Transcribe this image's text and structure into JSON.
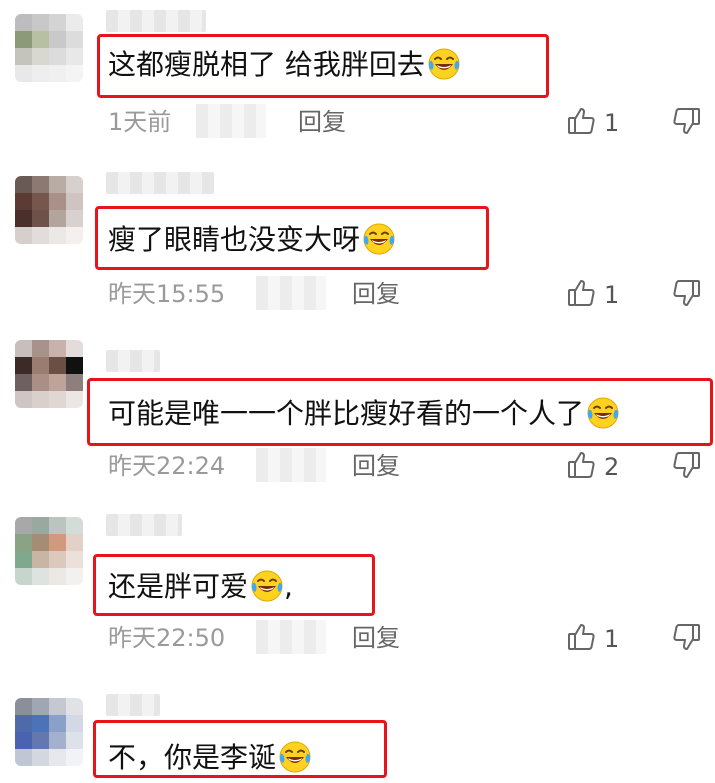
{
  "comments": [
    {
      "text": "这都瘦脱相了 给我胖回去",
      "time": "1天前",
      "reply": "回复",
      "likes": "1",
      "avatar": [
        "#bdbdbd",
        "#c8c8c8",
        "#d4d4d4",
        "#ebebeb",
        "#8d9a7a",
        "#b8c0a4",
        "#c9c9c9",
        "#dcdcdc",
        "#c4c4bc",
        "#d8d8d0",
        "#dcdcdc",
        "#e8e8e8",
        "#e8e8e8",
        "#eeeeee",
        "#f0f0f0",
        "#f4f4f4"
      ]
    },
    {
      "text": "瘦了眼睛也没变大呀",
      "time": "昨天15:55",
      "reply": "回复",
      "likes": "1",
      "avatar": [
        "#6a5a55",
        "#8c7a72",
        "#b9aca4",
        "#d8d0cc",
        "#5b3b33",
        "#77574d",
        "#a99088",
        "#cfc4bf",
        "#4a2f2a",
        "#6e524a",
        "#b3a49d",
        "#d9d1ce",
        "#d6cfcc",
        "#e2dcda",
        "#ece8e6",
        "#f3f0ee"
      ]
    },
    {
      "text": "可能是唯一一个胖比瘦好看的一个人了",
      "time": "昨天22:24",
      "reply": "回复",
      "likes": "2",
      "avatar": [
        "#c8bfbd",
        "#a8928c",
        "#c7b3ac",
        "#e3dcda",
        "#3c2a26",
        "#9a7c70",
        "#6c4f44",
        "#111111",
        "#6e6060",
        "#ab8f86",
        "#bda39a",
        "#8e7f7c",
        "#cfc6c4",
        "#d9cfcb",
        "#e0d6d2",
        "#ece6e4"
      ]
    },
    {
      "text": "还是胖可爱",
      "time": "昨天22:50",
      "reply": "回复",
      "likes": "1",
      "suffix": ",",
      "avatar": [
        "#a8a8a8",
        "#99a9a0",
        "#b9c5be",
        "#d4dcd8",
        "#8aa384",
        "#a58c74",
        "#d19a7e",
        "#e3d0c6",
        "#7fa88c",
        "#c9b5a4",
        "#dcc8bc",
        "#ebe0da",
        "#c6d6cc",
        "#dde4df",
        "#ece8e4",
        "#f3f1ef"
      ]
    },
    {
      "text": "不，你是李诞",
      "time": "",
      "reply": "",
      "likes": "",
      "avatar": [
        "#8a8f9a",
        "#a0a6b2",
        "#c4c8d0",
        "#e0e2e6",
        "#4e6aa8",
        "#4a73b8",
        "#8aa0c8",
        "#d2d8e4",
        "#4a63b0",
        "#6478b0",
        "#a5b1cc",
        "#dde1ea",
        "#c0c6d4",
        "#d3d7e0",
        "#e6e8ee",
        "#f2f3f6"
      ]
    }
  ]
}
